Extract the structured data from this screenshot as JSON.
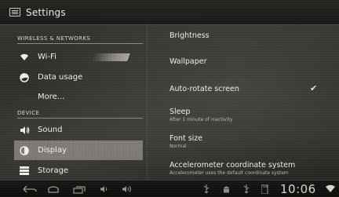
{
  "action_bar": {
    "title": "Settings",
    "icon": "settings-app-icon"
  },
  "sidebar": {
    "headers": {
      "wireless": "WIRELESS & NETWORKS",
      "device": "DEVICE"
    },
    "items": [
      {
        "label": "Wi-Fi",
        "icon": "wifi-icon",
        "selected": false
      },
      {
        "label": "Data usage",
        "icon": "data-usage-icon",
        "selected": false
      },
      {
        "label": "More...",
        "icon": "",
        "selected": false
      },
      {
        "label": "Sound",
        "icon": "speaker-icon",
        "selected": false
      },
      {
        "label": "Display",
        "icon": "display-icon",
        "selected": true
      },
      {
        "label": "Storage",
        "icon": "storage-icon",
        "selected": false
      }
    ]
  },
  "display_settings": {
    "items": [
      {
        "title": "Brightness",
        "summary": ""
      },
      {
        "title": "Wallpaper",
        "summary": ""
      },
      {
        "title": "Auto-rotate screen",
        "summary": "",
        "checked": true
      },
      {
        "title": "Sleep",
        "summary": "After 1 minute of inactivity"
      },
      {
        "title": "Font size",
        "summary": "Normal"
      },
      {
        "title": "Accelerometer coordinate system",
        "summary": "Accelerometer uses the default coordinate system"
      }
    ]
  },
  "system_bar": {
    "clock": "10:06",
    "nav_buttons": [
      "back-icon",
      "home-icon",
      "recent-apps-icon",
      "volume-down-icon",
      "volume-up-icon"
    ],
    "status_icons": [
      "usb-icon",
      "android-debug-icon",
      "usb-icon",
      "sd-card-icon",
      "wifi-signal-icon"
    ]
  },
  "colors": {
    "selected_bg": "#c9c4b9",
    "text": "#f1efe9",
    "action_bar": "#1f1e1b"
  }
}
